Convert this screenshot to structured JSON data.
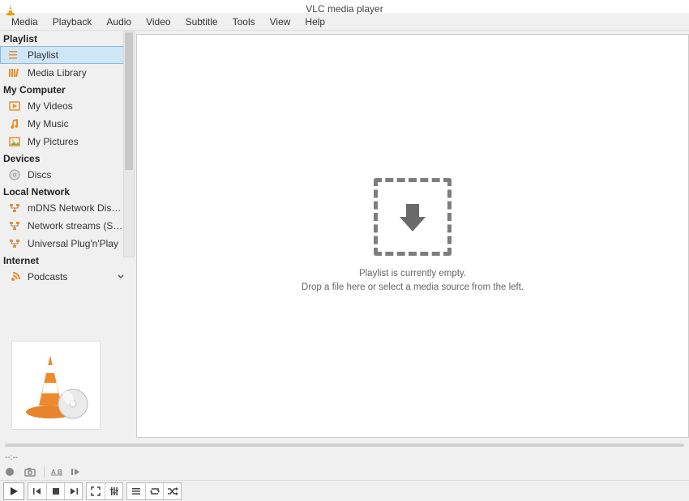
{
  "title": "VLC media player",
  "menu": {
    "items": [
      "Media",
      "Playback",
      "Audio",
      "Video",
      "Subtitle",
      "Tools",
      "View",
      "Help"
    ]
  },
  "sidebar": {
    "playlist_head": "Playlist",
    "playlist_items": [
      "Playlist",
      "Media Library"
    ],
    "mycomputer_head": "My Computer",
    "mycomputer_items": [
      "My Videos",
      "My Music",
      "My Pictures"
    ],
    "devices_head": "Devices",
    "devices_items": [
      "Discs"
    ],
    "localnet_head": "Local Network",
    "localnet_items": [
      "mDNS Network Disco...",
      "Network streams (SAP)",
      "Universal Plug'n'Play"
    ],
    "internet_head": "Internet",
    "internet_items": [
      "Podcasts"
    ]
  },
  "empty": {
    "line1": "Playlist is currently empty.",
    "line2": "Drop a file here or select a media source from the left."
  },
  "time_label": "--:--"
}
